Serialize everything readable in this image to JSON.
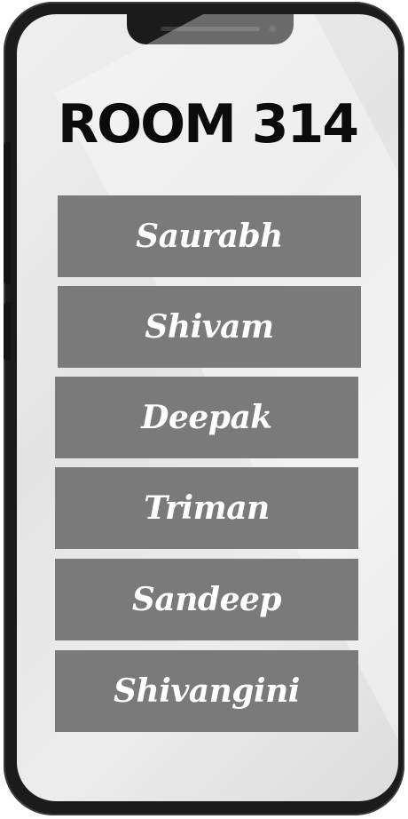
{
  "room": {
    "title": "ROOM 314"
  },
  "members": [
    {
      "name": "Saurabh"
    },
    {
      "name": "Shivam"
    },
    {
      "name": "Deepak"
    },
    {
      "name": "Triman"
    },
    {
      "name": "Sandeep"
    },
    {
      "name": "Shivangini"
    }
  ],
  "colors": {
    "tile": "#7a7a7a",
    "screen": "#e8e8e8",
    "phone_frame": "#1b1b1b",
    "title": "#0b0b0b"
  }
}
